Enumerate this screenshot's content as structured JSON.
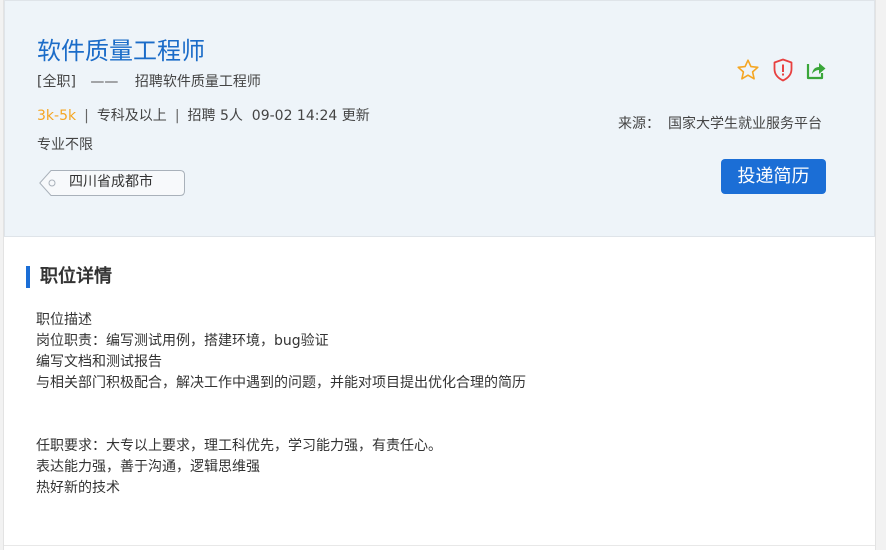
{
  "job": {
    "title": "软件质量工程师",
    "type": "[全职]",
    "dash": "——",
    "subtitle": "招聘软件质量工程师",
    "salary": "3k-5k",
    "sep": "|",
    "education": "专科及以上",
    "headcount": "招聘 5人",
    "updated": "09-02 14:24 更新",
    "major": "专业不限",
    "location": "四川省成都市"
  },
  "source": {
    "label": "来源：",
    "name": "国家大学生就业服务平台"
  },
  "actions": {
    "apply_label": "投递简历",
    "favorite_icon": "star-outline-icon",
    "report_icon": "shield-alert-icon",
    "share_icon": "share-arrow-icon"
  },
  "details": {
    "section_title": "职位详情",
    "lines": [
      "职位描述",
      "岗位职责：编写测试用例，搭建环境，bug验证",
      "编写文档和测试报告",
      "与相关部门积极配合，解决工作中遇到的问题，并能对项目提出优化合理的简历",
      "",
      "",
      "任职要求：大专以上要求，理工科优先，学习能力强，有责任心。",
      "表达能力强，善于沟通，逻辑思维强",
      "热好新的技术"
    ]
  },
  "colors": {
    "accent": "#1b6ed6",
    "title": "#1b6cc8",
    "salary": "#f5a623",
    "star": "#f5a623",
    "shield": "#e84040",
    "share": "#3aa63a",
    "header_bg": "#eef4f9"
  }
}
